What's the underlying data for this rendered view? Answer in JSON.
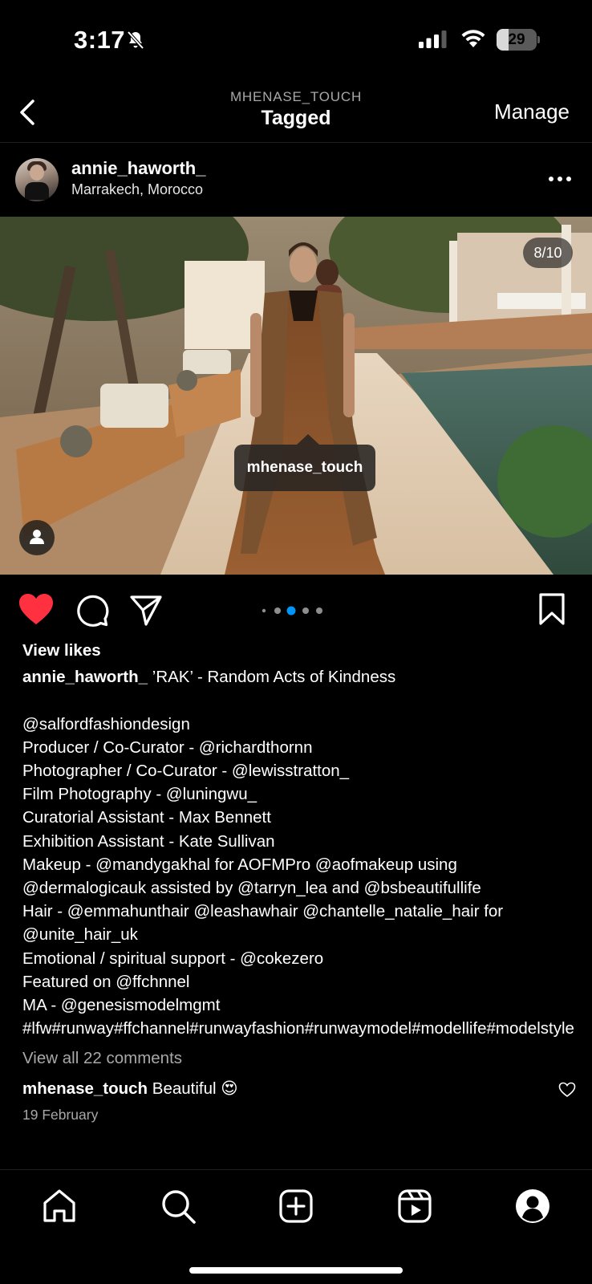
{
  "status_bar": {
    "time": "3:17",
    "battery": "29",
    "battery_level": 0.29
  },
  "header": {
    "account": "MHENASE_TOUCH",
    "title": "Tagged",
    "manage_label": "Manage"
  },
  "post": {
    "username": "annie_haworth_",
    "location": "Marrakech, Morocco",
    "media_counter": "8/10",
    "tag_label": "mhenase_touch",
    "carousel_dots": 5,
    "carousel_active_index": 2,
    "liked": true
  },
  "caption": {
    "view_likes": "View likes",
    "username": "annie_haworth_",
    "first_line": "’RAK’ - Random Acts of Kindness",
    "body": "\n\n@salfordfashiondesign\nProducer / Co-Curator - @richardthornn\nPhotographer / Co-Curator - @lewisstratton_\nFilm Photography - @luningwu_\nCuratorial Assistant - Max Bennett\nExhibition Assistant - Kate Sullivan\nMakeup - @mandygakhal for AOFMPro @aofmakeup using @dermalogicauk assisted by @tarryn_lea and @bsbeautifullife\nHair - @emmahunthair @leashawhair @chantelle_natalie_hair for @unite_hair_uk\nEmotional / spiritual support - @cokezero\nFeatured on @ffchnnel\nMA - @genesismodelmgmt\n#lfw#runway#ffchannel#runwayfashion#runwaymodel#modellife#modelstyle",
    "view_comments": "View all 22 comments"
  },
  "comment": {
    "username": "mhenase_touch",
    "text": "Beautiful 😍",
    "date": "19 February"
  },
  "icons": {
    "back": "chevron-left-icon",
    "more": "more-dots-icon",
    "like": "heart-filled-icon",
    "comment": "comment-bubble-icon",
    "share": "paper-plane-icon",
    "save": "bookmark-icon",
    "home": "home-icon",
    "search": "search-icon",
    "create": "plus-square-icon",
    "reels": "reels-icon",
    "profile": "profile-icon",
    "user_tag": "person-icon"
  },
  "colors": {
    "like": "#ff3040",
    "active_dot": "#0095f6",
    "inactive_dot": "#8e8e8e",
    "secondary_text": "#a8a8a8"
  }
}
